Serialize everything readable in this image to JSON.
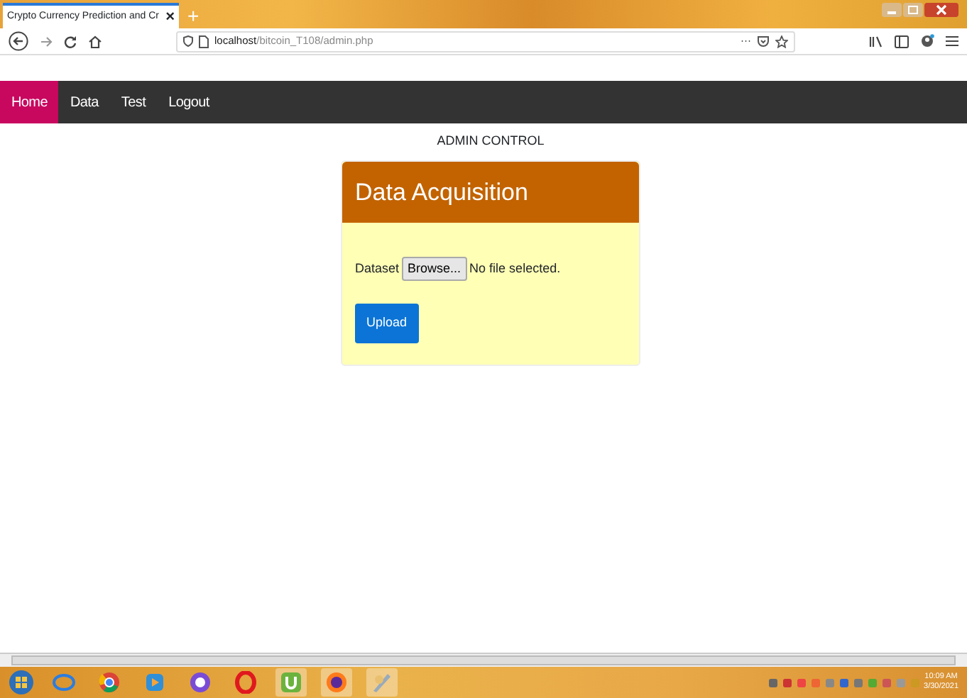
{
  "browser": {
    "tab_title": "Crypto Currency Prediction and Cr",
    "tab_close": "×",
    "new_tab": "+",
    "url_host": "localhost",
    "url_path": "/bitcoin_T108/admin.php",
    "url_more": "···"
  },
  "nav": [
    {
      "label": "Home",
      "selected": true
    },
    {
      "label": "Data",
      "selected": false
    },
    {
      "label": "Test",
      "selected": false
    },
    {
      "label": "Logout",
      "selected": false
    }
  ],
  "heading": "ADMIN CONTROL",
  "card": {
    "title": "Data Acquisition",
    "field_label": "Dataset",
    "browse_button": "Browse...",
    "file_status": "No file selected.",
    "upload_button": "Upload"
  },
  "taskbar": {
    "time": "10:09 AM",
    "date": "3/30/2021"
  }
}
